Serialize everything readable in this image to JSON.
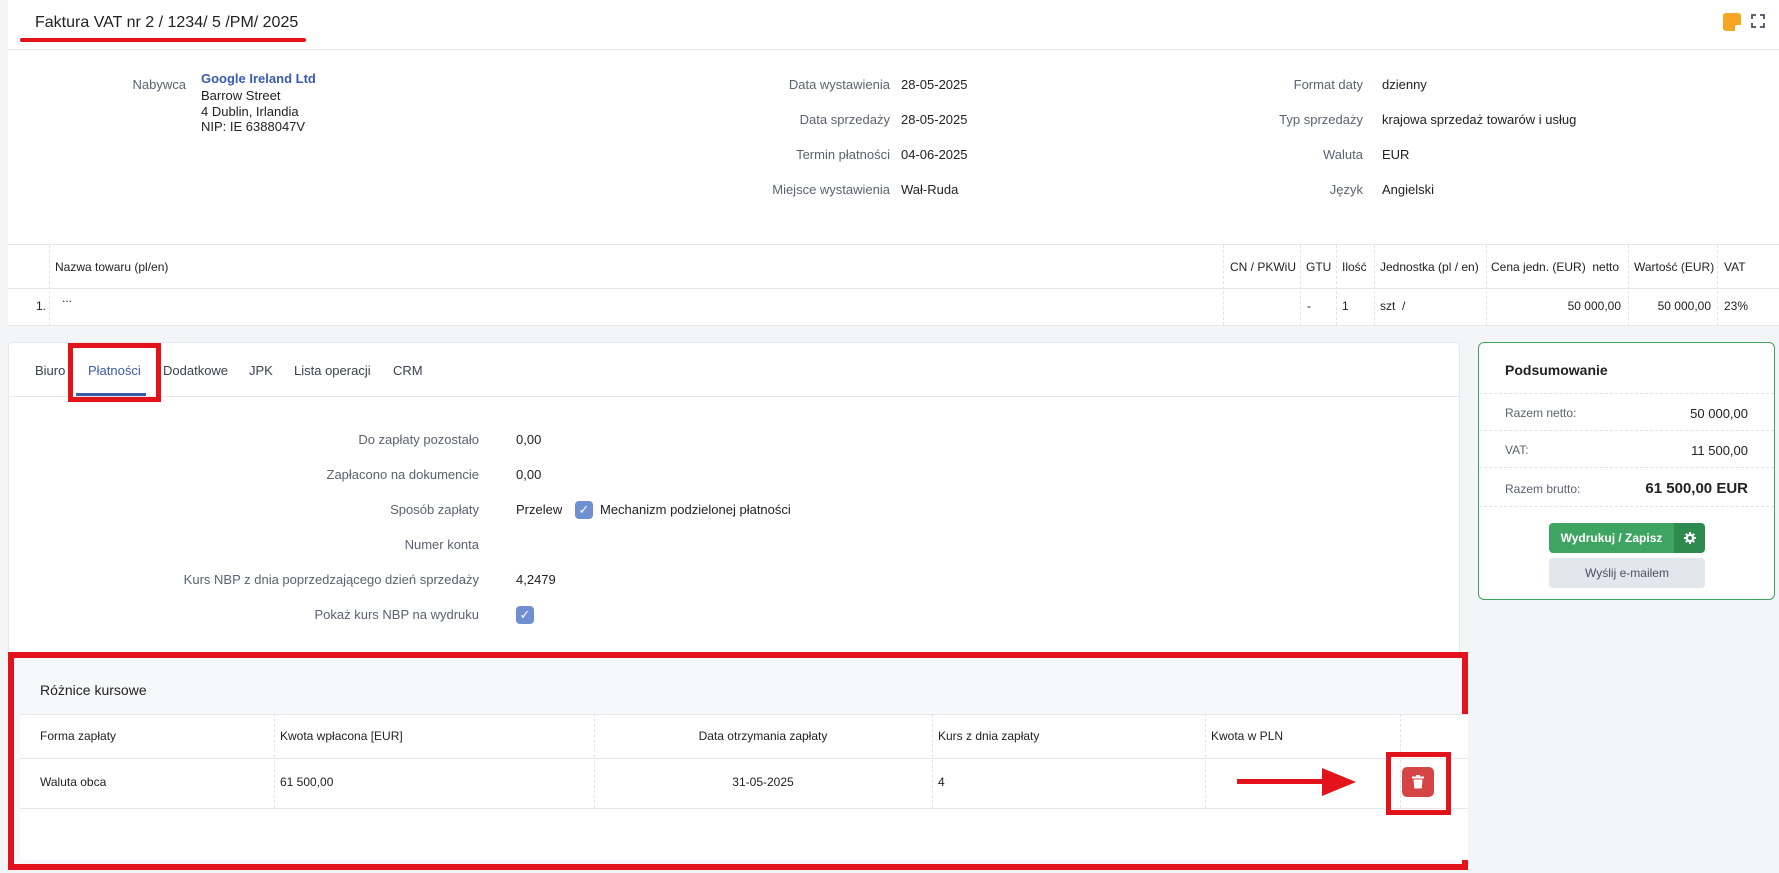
{
  "header": {
    "title": "Faktura VAT nr 2 / 1234/ 5 /PM/ 2025"
  },
  "buyer": {
    "label": "Nabywca",
    "name": "Google Ireland Ltd",
    "street": "Barrow Street",
    "city": "4 Dublin, Irlandia",
    "nip": "NIP: IE 6388047V"
  },
  "dates": [
    {
      "label": "Data wystawienia",
      "value": "28-05-2025"
    },
    {
      "label": "Data sprzedaży",
      "value": "28-05-2025"
    },
    {
      "label": "Termin płatności",
      "value": "04-06-2025"
    },
    {
      "label": "Miejsce wystawienia",
      "value": "Wał-Ruda"
    }
  ],
  "settings": [
    {
      "label": "Format daty",
      "value": "dzienny"
    },
    {
      "label": "Typ sprzedaży",
      "value": "krajowa sprzedaż towarów i usług"
    },
    {
      "label": "Waluta",
      "value": "EUR"
    },
    {
      "label": "Język",
      "value": "Angielski"
    }
  ],
  "items": {
    "headers": {
      "name": "Nazwa towaru (pl/en)",
      "cn": "CN / PKWiU",
      "gtu": "GTU",
      "qty": "Ilość",
      "unit": "Jednostka (pl / en)",
      "price": "Cena jedn. (EUR)  netto",
      "value": "Wartość (EUR)",
      "vat": "VAT"
    },
    "rows": [
      {
        "no": "1.",
        "name": "...",
        "cn": "",
        "gtu": "-",
        "qty": "1",
        "unit": "szt  /",
        "price": "50 000,00",
        "value": "50 000,00",
        "vat": "23%"
      }
    ]
  },
  "tabs": [
    "Biuro",
    "Płatności",
    "Dodatkowe",
    "JPK",
    "Lista operacji",
    "CRM"
  ],
  "payment": {
    "remaining_label": "Do zapłaty pozostało",
    "remaining": "0,00",
    "paid_label": "Zapłacono na dokumencie",
    "paid": "0,00",
    "method_label": "Sposób zapłaty",
    "method": "Przelew",
    "split_label": "Mechanizm podzielonej płatności",
    "account_label": "Numer konta",
    "account": "",
    "nbp_label": "Kurs NBP z dnia poprzedzającego dzień sprzedaży",
    "nbp": "4,2479",
    "show_nbp_label": "Pokaż kurs NBP na wydruku"
  },
  "fx": {
    "title": "Różnice kursowe",
    "headers": {
      "form": "Forma zapłaty",
      "amount": "Kwota wpłacona [EUR]",
      "date": "Data otrzymania zapłaty",
      "rate": "Kurs z dnia zapłaty",
      "pln": "Kwota w PLN"
    },
    "rows": [
      {
        "form": "Waluta obca",
        "amount": "61 500,00",
        "date": "31-05-2025",
        "rate": "4",
        "pln": ""
      }
    ]
  },
  "summary": {
    "title": "Podsumowanie",
    "net_label": "Razem netto:",
    "net": "50 000,00",
    "vat_label": "VAT:",
    "vat": "11 500,00",
    "gross_label": "Razem brutto:",
    "gross": "61 500,00 EUR",
    "print_label": "Wydrukuj / Zapisz",
    "mail_label": "Wyślij e-mailem"
  },
  "colors": {
    "accent": "#3b5bab",
    "green": "#3ea461",
    "annotation_red": "#e3131b",
    "delete": "#d64545"
  }
}
